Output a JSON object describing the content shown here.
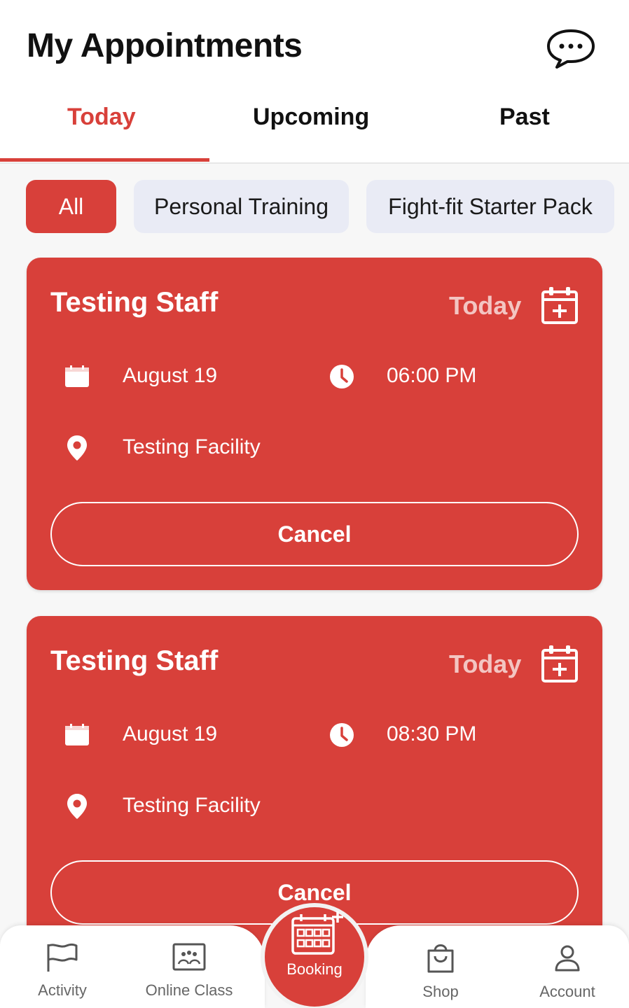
{
  "header": {
    "title": "My Appointments"
  },
  "tabs": [
    {
      "label": "Today",
      "active": true
    },
    {
      "label": "Upcoming",
      "active": false
    },
    {
      "label": "Past",
      "active": false
    }
  ],
  "filters": [
    {
      "label": "All",
      "active": true
    },
    {
      "label": "Personal Training",
      "active": false
    },
    {
      "label": "Fight-fit Starter Pack",
      "active": false
    }
  ],
  "appointments": [
    {
      "staff": "Testing Staff",
      "day": "Today",
      "date": "August 19",
      "time": "06:00 PM",
      "location": "Testing Facility",
      "cancel_label": "Cancel"
    },
    {
      "staff": "Testing Staff",
      "day": "Today",
      "date": "August 19",
      "time": "08:30 PM",
      "location": "Testing Facility",
      "cancel_label": "Cancel"
    }
  ],
  "bottom_nav": [
    {
      "label": "Activity",
      "icon": "flag-icon"
    },
    {
      "label": "Online Class",
      "icon": "online-class-icon"
    },
    {
      "label": "Booking",
      "icon": "calendar-grid-plus-icon"
    },
    {
      "label": "Shop",
      "icon": "shopping-bag-icon"
    },
    {
      "label": "Account",
      "icon": "user-icon"
    }
  ],
  "colors": {
    "accent": "#d8403a",
    "chip_bg": "#e9ebf5",
    "muted_text": "#f3c5c2"
  }
}
